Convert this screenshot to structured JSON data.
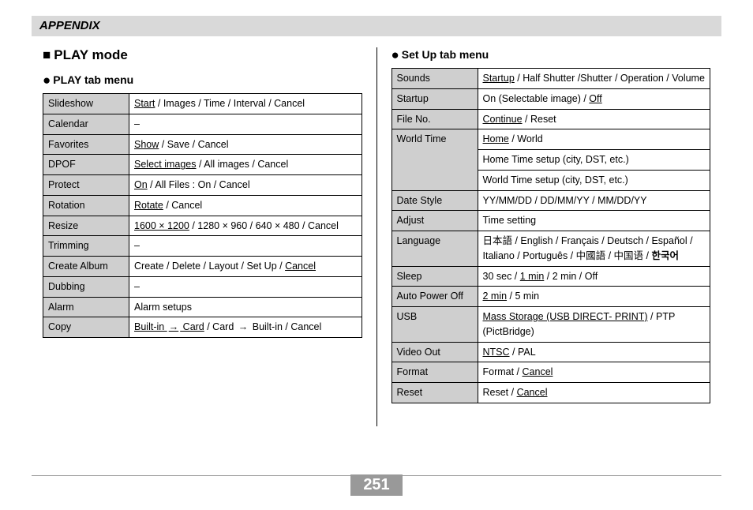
{
  "header": {
    "appendix": "APPENDIX"
  },
  "left": {
    "section_title": "PLAY mode",
    "sub_title": "PLAY tab menu",
    "rows": [
      {
        "label": "Slideshow",
        "value": "<span class='u'>Start</span> / Images / Time / Interval / Cancel"
      },
      {
        "label": "Calendar",
        "value": "–"
      },
      {
        "label": "Favorites",
        "value": "<span class='u'>Show</span> / Save / Cancel"
      },
      {
        "label": "DPOF",
        "value": "<span class='u'>Select images</span> / All images / Cancel"
      },
      {
        "label": "Protect",
        "value": "<span class='u'>On</span> / All Files : On / Cancel"
      },
      {
        "label": "Rotation",
        "value": "<span class='u'>Rotate</span> / Cancel"
      },
      {
        "label": "Resize",
        "value": "<span class='u'>1600 × 1200</span> / 1280 × 960 / 640 × 480 / Cancel"
      },
      {
        "label": "Trimming",
        "value": "–"
      },
      {
        "label": "Create Album",
        "value": "Create / Delete / Layout / Set Up / <span class='u'>Cancel</span>"
      },
      {
        "label": "Dubbing",
        "value": "–"
      },
      {
        "label": "Alarm",
        "value": "Alarm setups"
      },
      {
        "label": "Copy",
        "value": "<span class='u'>Built-in <span class='arrow'>→</span> Card</span> / Card <span class='arrow'>→</span> Built-in / Cancel"
      }
    ]
  },
  "right": {
    "sub_title": "Set Up tab menu",
    "rows": [
      {
        "label": "Sounds",
        "value": "<span class='u'>Startup</span> / Half Shutter /Shutter / Operation / Volume"
      },
      {
        "label": "Startup",
        "value": "On (Selectable image) / <span class='u'>Off</span>"
      },
      {
        "label": "File No.",
        "value": "<span class='u'>Continue</span> / Reset"
      },
      {
        "label": "World Time",
        "value": "<span class='u'>Home</span> / World",
        "extra": [
          "Home Time setup (city, DST, etc.)",
          "World Time setup (city, DST, etc.)"
        ]
      },
      {
        "label": "Date Style",
        "value": "YY/MM/DD / DD/MM/YY / MM/DD/YY"
      },
      {
        "label": "Adjust",
        "value": "Time setting"
      },
      {
        "label": "Language",
        "value": "日本語 / English / Français / Deutsch / Español / Italiano / Português / 中國語 / 中国语 / <b>한국어</b>"
      },
      {
        "label": "Sleep",
        "value": "30 sec / <span class='u'>1 min</span> / 2 min / Off"
      },
      {
        "label": "Auto Power Off",
        "value": "<span class='u'>2 min</span> / 5 min"
      },
      {
        "label": "USB",
        "value": "<span class='u'>Mass Storage (USB DIRECT- PRINT)</span> / PTP (PictBridge)"
      },
      {
        "label": "Video Out",
        "value": "<span class='u'>NTSC</span> / PAL"
      },
      {
        "label": "Format",
        "value": "Format / <span class='u'>Cancel</span>"
      },
      {
        "label": "Reset",
        "value": "Reset / <span class='u'>Cancel</span>"
      }
    ]
  },
  "page_number": "251"
}
